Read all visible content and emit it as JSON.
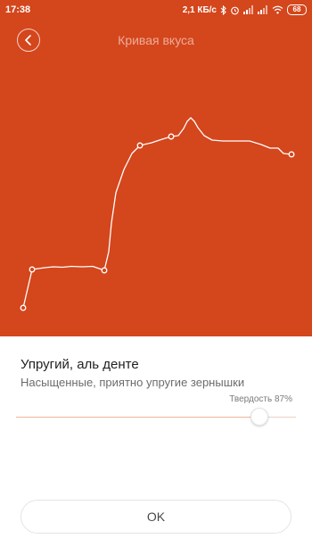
{
  "status_bar": {
    "time": "17:38",
    "speed": "2,1 КБ/с",
    "battery": "68",
    "icons": [
      "bluetooth-icon",
      "alarm-icon",
      "signal-icon",
      "signal-icon",
      "wifi-icon",
      "battery-icon"
    ]
  },
  "header": {
    "title": "Кривая вкуса",
    "back_icon": "back-chevron-icon"
  },
  "colors": {
    "accent": "#d4461c",
    "curve": "#ffffff"
  },
  "texture": {
    "name": "Упругий, аль денте",
    "description": "Насыщенные, приятно упругие зернышки",
    "hardness_label": "Твердость 87%",
    "hardness_value": 0.87
  },
  "ok_button": {
    "label": "OK"
  }
}
